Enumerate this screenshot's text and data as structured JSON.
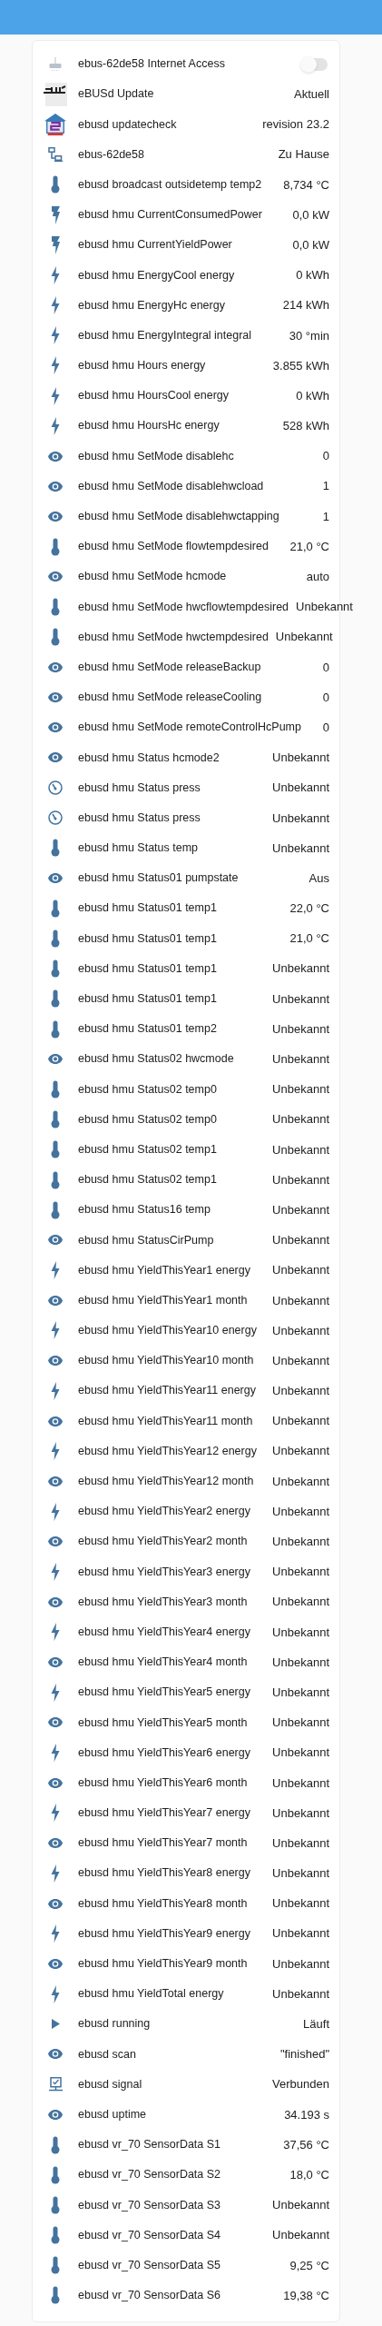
{
  "entities": [
    {
      "kind": "switch",
      "name": "ebus-62de58 Internet Access",
      "on": false
    },
    {
      "kind": "update-logo",
      "name": "eBUSd Update",
      "value": "Aktuell"
    },
    {
      "kind": "house-logo",
      "name": "ebusd updatecheck",
      "value": "revision 23.2"
    },
    {
      "kind": "network",
      "name": "ebus-62de58",
      "value": "Zu Hause"
    },
    {
      "kind": "temperature",
      "name": "ebusd broadcast outsidetemp temp2",
      "value": "8,734 °C"
    },
    {
      "kind": "power",
      "name": "ebusd hmu CurrentConsumedPower",
      "value": "0,0 kW"
    },
    {
      "kind": "power",
      "name": "ebusd hmu CurrentYieldPower",
      "value": "0,0 kW"
    },
    {
      "kind": "energy",
      "name": "ebusd hmu EnergyCool energy",
      "value": "0 kWh"
    },
    {
      "kind": "energy",
      "name": "ebusd hmu EnergyHc energy",
      "value": "214 kWh"
    },
    {
      "kind": "energy",
      "name": "ebusd hmu EnergyIntegral integral",
      "value": "30 °min"
    },
    {
      "kind": "energy",
      "name": "ebusd hmu Hours energy",
      "value": "3.855 kWh"
    },
    {
      "kind": "energy",
      "name": "ebusd hmu HoursCool energy",
      "value": "0 kWh"
    },
    {
      "kind": "energy",
      "name": "ebusd hmu HoursHc energy",
      "value": "528 kWh"
    },
    {
      "kind": "generic",
      "name": "ebusd hmu SetMode disablehc",
      "value": "0"
    },
    {
      "kind": "generic",
      "name": "ebusd hmu SetMode disablehwcload",
      "value": "1"
    },
    {
      "kind": "generic",
      "name": "ebusd hmu SetMode disablehwctapping",
      "value": "1"
    },
    {
      "kind": "temperature",
      "name": "ebusd hmu SetMode flowtempdesired",
      "value": "21,0 °C"
    },
    {
      "kind": "generic",
      "name": "ebusd hmu SetMode hcmode",
      "value": "auto"
    },
    {
      "kind": "temperature",
      "name": "ebusd hmu SetMode hwcflowtempdesired",
      "value": "Unbekannt"
    },
    {
      "kind": "temperature",
      "name": "ebusd hmu SetMode hwctempdesired",
      "value": "Unbekannt"
    },
    {
      "kind": "generic",
      "name": "ebusd hmu SetMode releaseBackup",
      "value": "0"
    },
    {
      "kind": "generic",
      "name": "ebusd hmu SetMode releaseCooling",
      "value": "0"
    },
    {
      "kind": "generic",
      "name": "ebusd hmu SetMode remoteControlHcPump",
      "value": "0"
    },
    {
      "kind": "generic",
      "name": "ebusd hmu Status hcmode2",
      "value": "Unbekannt"
    },
    {
      "kind": "pressure",
      "name": "ebusd hmu Status press",
      "value": "Unbekannt"
    },
    {
      "kind": "pressure",
      "name": "ebusd hmu Status press",
      "value": "Unbekannt"
    },
    {
      "kind": "temperature",
      "name": "ebusd hmu Status temp",
      "value": "Unbekannt"
    },
    {
      "kind": "generic",
      "name": "ebusd hmu Status01 pumpstate",
      "value": "Aus"
    },
    {
      "kind": "temperature",
      "name": "ebusd hmu Status01 temp1",
      "value": "22,0 °C"
    },
    {
      "kind": "temperature",
      "name": "ebusd hmu Status01 temp1",
      "value": "21,0 °C"
    },
    {
      "kind": "temperature",
      "name": "ebusd hmu Status01 temp1",
      "value": "Unbekannt"
    },
    {
      "kind": "temperature",
      "name": "ebusd hmu Status01 temp1",
      "value": "Unbekannt"
    },
    {
      "kind": "temperature",
      "name": "ebusd hmu Status01 temp2",
      "value": "Unbekannt"
    },
    {
      "kind": "generic",
      "name": "ebusd hmu Status02 hwcmode",
      "value": "Unbekannt"
    },
    {
      "kind": "temperature",
      "name": "ebusd hmu Status02 temp0",
      "value": "Unbekannt"
    },
    {
      "kind": "temperature",
      "name": "ebusd hmu Status02 temp0",
      "value": "Unbekannt"
    },
    {
      "kind": "temperature",
      "name": "ebusd hmu Status02 temp1",
      "value": "Unbekannt"
    },
    {
      "kind": "temperature",
      "name": "ebusd hmu Status02 temp1",
      "value": "Unbekannt"
    },
    {
      "kind": "temperature",
      "name": "ebusd hmu Status16 temp",
      "value": "Unbekannt"
    },
    {
      "kind": "generic",
      "name": "ebusd hmu StatusCirPump",
      "value": "Unbekannt"
    },
    {
      "kind": "energy",
      "name": "ebusd hmu YieldThisYear1 energy",
      "value": "Unbekannt"
    },
    {
      "kind": "generic",
      "name": "ebusd hmu YieldThisYear1 month",
      "value": "Unbekannt"
    },
    {
      "kind": "energy",
      "name": "ebusd hmu YieldThisYear10 energy",
      "value": "Unbekannt"
    },
    {
      "kind": "generic",
      "name": "ebusd hmu YieldThisYear10 month",
      "value": "Unbekannt"
    },
    {
      "kind": "energy",
      "name": "ebusd hmu YieldThisYear11 energy",
      "value": "Unbekannt"
    },
    {
      "kind": "generic",
      "name": "ebusd hmu YieldThisYear11 month",
      "value": "Unbekannt"
    },
    {
      "kind": "energy",
      "name": "ebusd hmu YieldThisYear12 energy",
      "value": "Unbekannt"
    },
    {
      "kind": "generic",
      "name": "ebusd hmu YieldThisYear12 month",
      "value": "Unbekannt"
    },
    {
      "kind": "energy",
      "name": "ebusd hmu YieldThisYear2 energy",
      "value": "Unbekannt"
    },
    {
      "kind": "generic",
      "name": "ebusd hmu YieldThisYear2 month",
      "value": "Unbekannt"
    },
    {
      "kind": "energy",
      "name": "ebusd hmu YieldThisYear3 energy",
      "value": "Unbekannt"
    },
    {
      "kind": "generic",
      "name": "ebusd hmu YieldThisYear3 month",
      "value": "Unbekannt"
    },
    {
      "kind": "energy",
      "name": "ebusd hmu YieldThisYear4 energy",
      "value": "Unbekannt"
    },
    {
      "kind": "generic",
      "name": "ebusd hmu YieldThisYear4 month",
      "value": "Unbekannt"
    },
    {
      "kind": "energy",
      "name": "ebusd hmu YieldThisYear5 energy",
      "value": "Unbekannt"
    },
    {
      "kind": "generic",
      "name": "ebusd hmu YieldThisYear5 month",
      "value": "Unbekannt"
    },
    {
      "kind": "energy",
      "name": "ebusd hmu YieldThisYear6 energy",
      "value": "Unbekannt"
    },
    {
      "kind": "generic",
      "name": "ebusd hmu YieldThisYear6 month",
      "value": "Unbekannt"
    },
    {
      "kind": "energy",
      "name": "ebusd hmu YieldThisYear7 energy",
      "value": "Unbekannt"
    },
    {
      "kind": "generic",
      "name": "ebusd hmu YieldThisYear7 month",
      "value": "Unbekannt"
    },
    {
      "kind": "energy",
      "name": "ebusd hmu YieldThisYear8 energy",
      "value": "Unbekannt"
    },
    {
      "kind": "generic",
      "name": "ebusd hmu YieldThisYear8 month",
      "value": "Unbekannt"
    },
    {
      "kind": "energy",
      "name": "ebusd hmu YieldThisYear9 energy",
      "value": "Unbekannt"
    },
    {
      "kind": "generic",
      "name": "ebusd hmu YieldThisYear9 month",
      "value": "Unbekannt"
    },
    {
      "kind": "energy",
      "name": "ebusd hmu YieldTotal energy",
      "value": "Unbekannt"
    },
    {
      "kind": "running",
      "name": "ebusd running",
      "value": "Läuft"
    },
    {
      "kind": "generic",
      "name": "ebusd scan",
      "value": "\"finished\""
    },
    {
      "kind": "signal",
      "name": "ebusd signal",
      "value": "Verbunden"
    },
    {
      "kind": "generic",
      "name": "ebusd uptime",
      "value": "34.193 s"
    },
    {
      "kind": "temperature",
      "name": "ebusd vr_70 SensorData S1",
      "value": "37,56 °C"
    },
    {
      "kind": "temperature",
      "name": "ebusd vr_70 SensorData S2",
      "value": "18,0 °C"
    },
    {
      "kind": "temperature",
      "name": "ebusd vr_70 SensorData S3",
      "value": "Unbekannt"
    },
    {
      "kind": "temperature",
      "name": "ebusd vr_70 SensorData S4",
      "value": "Unbekannt"
    },
    {
      "kind": "temperature",
      "name": "ebusd vr_70 SensorData S5",
      "value": "9,25 °C"
    },
    {
      "kind": "temperature",
      "name": "ebusd vr_70 SensorData S6",
      "value": "19,38 °C"
    }
  ]
}
